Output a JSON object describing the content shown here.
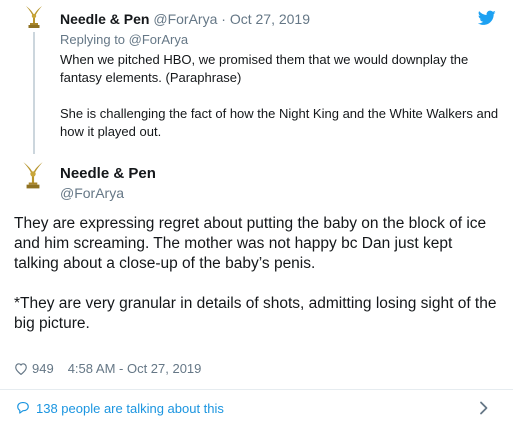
{
  "quoted_tweet": {
    "author_name": "Needle & Pen",
    "author_handle": "@ForArya",
    "separator": "·",
    "date": "Oct 27, 2019",
    "reply_prefix": "Replying to",
    "reply_handle": "@ForArya",
    "paragraphs": [
      "When we pitched HBO, we promised them that we would downplay the fantasy elements. (Paraphrase)",
      "She is challenging the fact of how the Night King and the White Walkers and how it played out."
    ]
  },
  "tweet": {
    "author_name": "Needle & Pen",
    "author_handle": "@ForArya",
    "paragraphs": [
      "They are expressing regret about putting the baby on the block of ice and him screaming. The mother was not happy bc Dan just kept talking about a close-up of the baby’s penis.",
      "*They are very granular in details of shots, admitting losing sight of the big picture."
    ],
    "like_count": "949",
    "timestamp": "4:58 AM - Oct 27, 2019"
  },
  "footer": {
    "label": "138 people are talking about this"
  },
  "icons": {
    "brand": "twitter-bird-icon",
    "like": "heart-icon",
    "conversation": "speech-bubble-icon",
    "more": "chevron-right-icon",
    "avatar": "emmy-statuette-avatar"
  },
  "colors": {
    "brand_blue": "#1da1f2",
    "link_blue": "#1b95e0",
    "secondary_text": "#657786",
    "primary_text": "#14171a",
    "avatar_gold": "#b8962e"
  }
}
